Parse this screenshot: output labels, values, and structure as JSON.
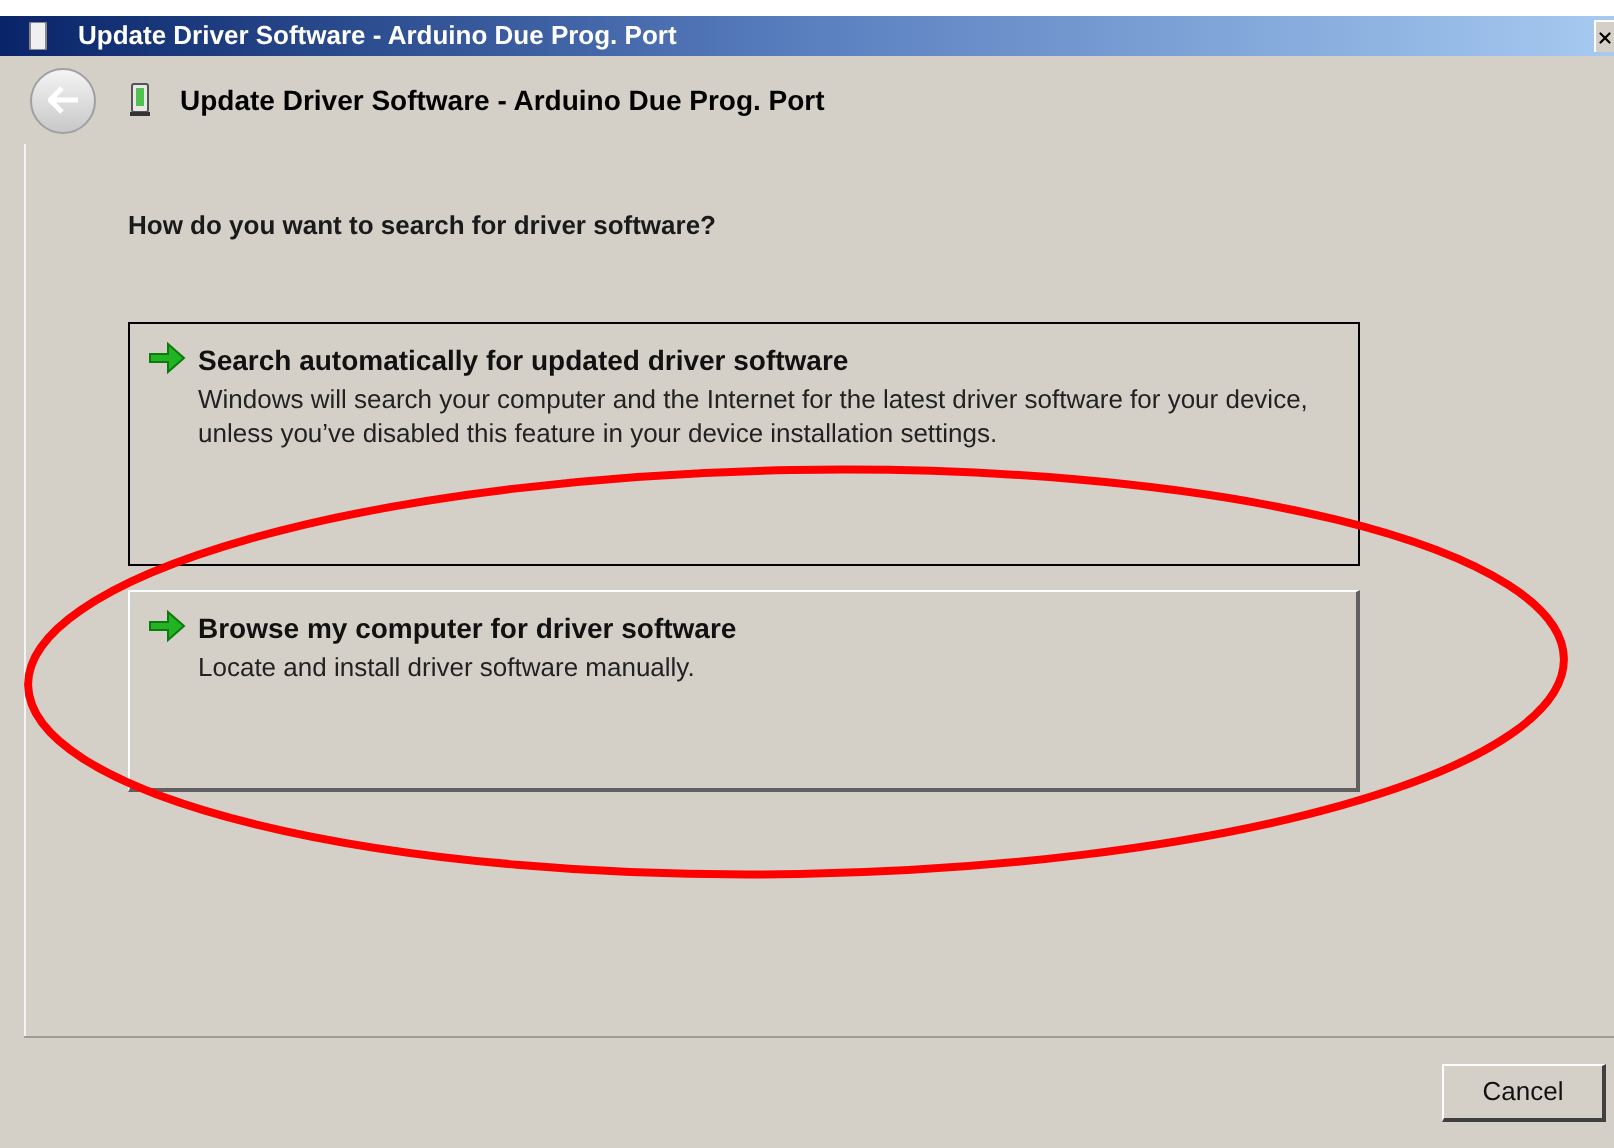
{
  "window": {
    "title": "Update Driver Software - Arduino Due Prog. Port"
  },
  "header": {
    "title": "Update Driver Software - Arduino Due Prog. Port"
  },
  "question": "How do you want to search for driver software?",
  "options": [
    {
      "title": "Search automatically for updated driver software",
      "description": "Windows will search your computer and the Internet for the latest driver software for your device, unless you’ve disabled this feature in your device installation settings.",
      "selected": true
    },
    {
      "title": "Browse my computer for driver software",
      "description": "Locate and install driver software manually.",
      "selected": false
    }
  ],
  "buttons": [
    "Cancel"
  ],
  "annotation": {
    "kind": "ellipse",
    "color": "#ff0000"
  }
}
